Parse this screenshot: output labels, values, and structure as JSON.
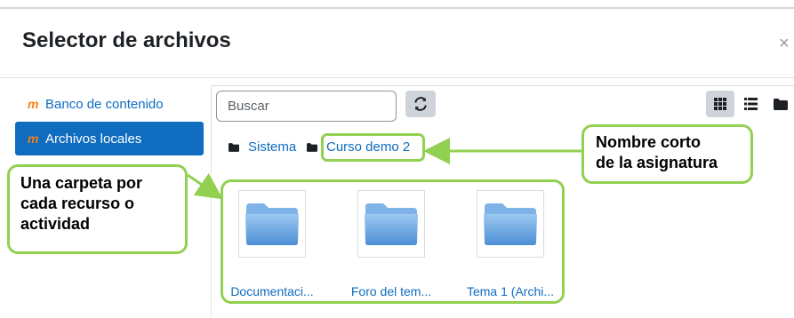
{
  "dialog": {
    "title": "Selector de archivos",
    "close_label": "×"
  },
  "sidebar": {
    "items": [
      {
        "label": "Banco de contenido",
        "icon": "moodle-icon",
        "active": false
      },
      {
        "label": "Archivos locales",
        "icon": "moodle-icon",
        "active": true
      }
    ]
  },
  "toolbar": {
    "search_placeholder": "Buscar",
    "refresh_icon": "refresh-icon",
    "view_modes": [
      "icons-view-icon",
      "list-view-icon",
      "tree-view-icon"
    ],
    "active_view": "icons"
  },
  "breadcrumb": [
    {
      "label": "Sistema",
      "icon": "folder-icon"
    },
    {
      "label": "Curso demo 2",
      "icon": "folder-icon"
    }
  ],
  "files": [
    {
      "name": "Documentaci...",
      "icon": "folder-icon"
    },
    {
      "name": "Foro del tem...",
      "icon": "folder-icon"
    },
    {
      "name": "Tema 1 (Archi...",
      "icon": "folder-icon"
    }
  ],
  "callouts": {
    "short_name": {
      "line1": "Nombre corto",
      "line2": "de la asignatura"
    },
    "folders": {
      "line1": "Una carpeta por",
      "line2": "cada recurso o",
      "line3": "actividad"
    }
  },
  "colors": {
    "accent": "#0f6cbf",
    "callout_border": "#92d050",
    "folder_blue": "#5b9bd5"
  }
}
